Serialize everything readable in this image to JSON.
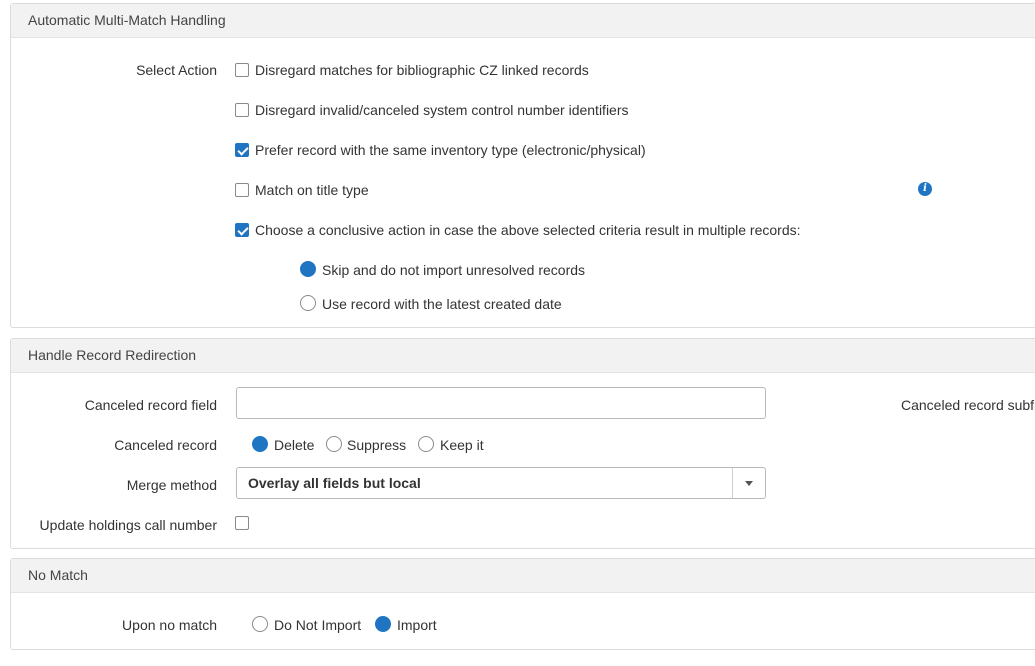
{
  "multi_match": {
    "title": "Automatic Multi-Match Handling",
    "select_action_label": "Select Action",
    "options": [
      {
        "label": "Disregard matches for bibliographic CZ linked records",
        "checked": false
      },
      {
        "label": "Disregard invalid/canceled system control number identifiers",
        "checked": false
      },
      {
        "label": "Prefer record with the same inventory type (electronic/physical)",
        "checked": true
      },
      {
        "label": "Match on title type",
        "checked": false
      },
      {
        "label": "Choose a conclusive action in case the above selected criteria result in multiple records:",
        "checked": true
      }
    ],
    "info_icon": "info-icon",
    "conclusive_options": [
      {
        "label": "Skip and do not import unresolved records",
        "selected": true
      },
      {
        "label": "Use record with the latest created date",
        "selected": false
      }
    ]
  },
  "redirection": {
    "title": "Handle Record Redirection",
    "canceled_field_label": "Canceled record field",
    "canceled_field_value": "",
    "canceled_subfield_label": "Canceled record subfi",
    "canceled_record_label": "Canceled record",
    "canceled_record_options": [
      {
        "label": "Delete",
        "selected": true
      },
      {
        "label": "Suppress",
        "selected": false
      },
      {
        "label": "Keep it",
        "selected": false
      }
    ],
    "merge_method_label": "Merge method",
    "merge_method_value": "Overlay all fields but local",
    "update_holdings_label": "Update holdings call number",
    "update_holdings_checked": false
  },
  "no_match": {
    "title": "No Match",
    "upon_no_match_label": "Upon no match",
    "options": [
      {
        "label": "Do Not Import",
        "selected": false
      },
      {
        "label": "Import",
        "selected": true
      }
    ]
  },
  "colors": {
    "accent": "#1f75c2",
    "header_bg": "#f2f2f2"
  }
}
